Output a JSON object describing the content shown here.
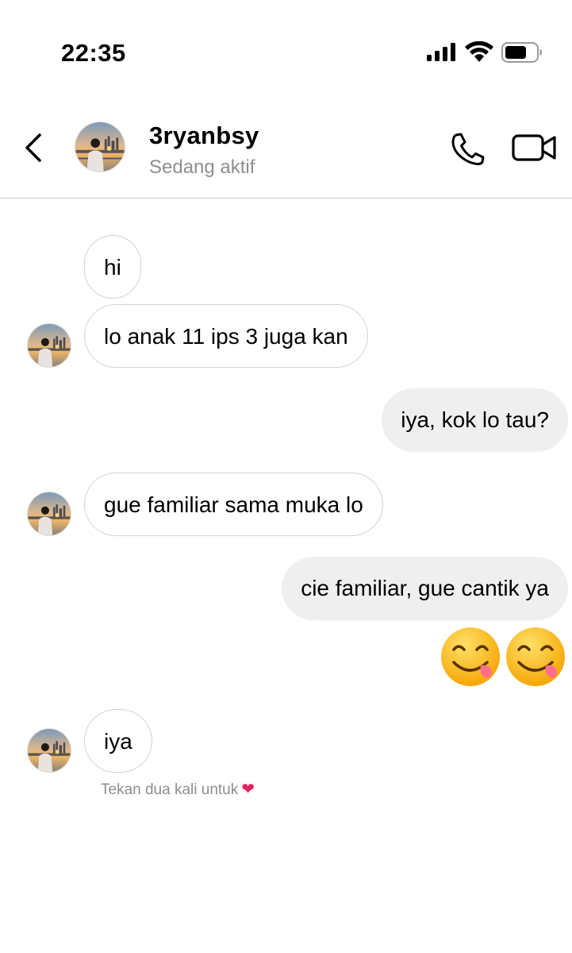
{
  "status_bar": {
    "time": "22:35"
  },
  "header": {
    "back_icon": "chevron-left-icon",
    "username": "3ryanbsy",
    "activity": "Sedang aktif",
    "call_icon": "phone-icon",
    "video_icon": "video-camera-icon"
  },
  "messages": [
    {
      "direction": "incoming",
      "text": "hi"
    },
    {
      "direction": "incoming",
      "text": "lo anak 11 ips 3 juga kan"
    },
    {
      "direction": "outgoing",
      "text": "iya, kok lo tau?"
    },
    {
      "direction": "incoming",
      "text": "gue familiar sama muka lo"
    },
    {
      "direction": "outgoing",
      "text": "cie familiar, gue cantik ya"
    },
    {
      "direction": "outgoing",
      "text": "😋😋",
      "type": "emoji",
      "icons": [
        "yum-emoji-icon",
        "yum-emoji-icon"
      ]
    },
    {
      "direction": "incoming",
      "text": "iya"
    }
  ],
  "hint": {
    "text": "Tekan dua kali untuk",
    "icon": "heart-icon",
    "glyph": "❤"
  },
  "colors": {
    "incoming_border": "#d3d3d3",
    "outgoing_bg": "#efefef",
    "secondary_text": "#8e8e8e",
    "heart": "#e0245e"
  }
}
